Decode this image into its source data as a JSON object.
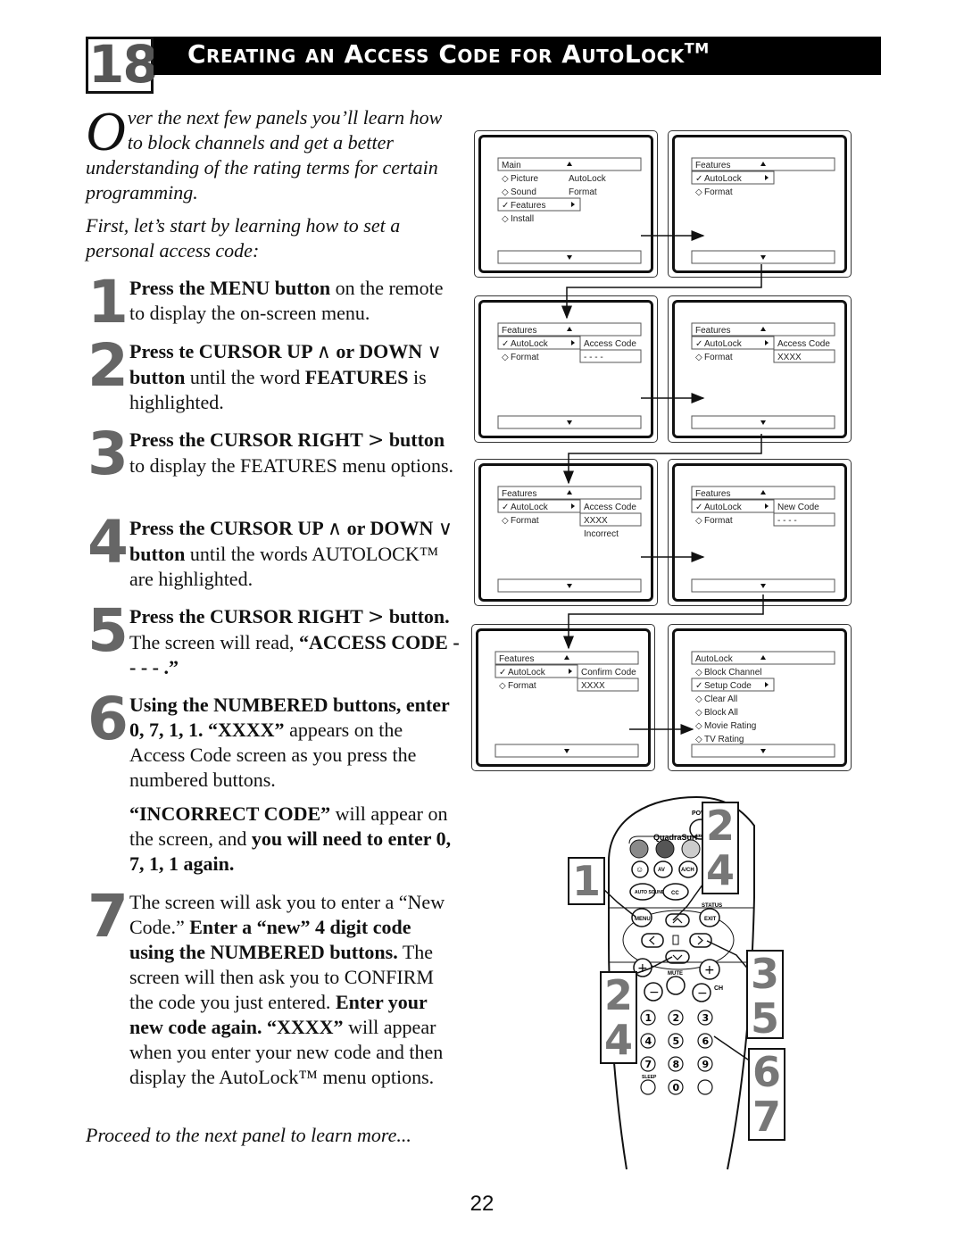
{
  "header": {
    "section_number": "18",
    "title": "Creating an Access Code for AutoLock",
    "title_trademark": "TM"
  },
  "intro": {
    "dropcap": "O",
    "paragraph1_rest": "ver the next few panels you’ll learn how to block channels and get a better understanding of the rating terms for certain programming.",
    "paragraph2": "First, let’s start by learning how to set a personal access code:"
  },
  "steps": [
    {
      "number": "1",
      "parts": [
        {
          "b": "Press the MENU button"
        },
        {
          "t": " on the remote to display the on-screen menu."
        }
      ]
    },
    {
      "number": "2",
      "parts": [
        {
          "b": "Press te CURSOR UP "
        },
        {
          "s": "∧"
        },
        {
          "b": "  or  DOWN "
        },
        {
          "s": "∨"
        },
        {
          "b": "  button"
        },
        {
          "t": " until the word "
        },
        {
          "b": "FEATURES"
        },
        {
          "t": " is highlighted."
        }
      ]
    },
    {
      "number": "3",
      "parts": [
        {
          "b": "Press the CURSOR RIGHT "
        },
        {
          "s": ">"
        },
        {
          "b": " button"
        },
        {
          "t": " to display the FEATURES menu options."
        }
      ]
    },
    {
      "number": "4",
      "parts": [
        {
          "b": "Press the CURSOR UP "
        },
        {
          "s": "∧"
        },
        {
          "b": "  or DOWN "
        },
        {
          "s": "∨"
        },
        {
          "b": " button"
        },
        {
          "t": " until the words AUTOLOCK™ are highlighted."
        }
      ]
    },
    {
      "number": "5",
      "parts": [
        {
          "b": "Press the CURSOR RIGHT "
        },
        {
          "s": ">"
        },
        {
          "b": " button."
        },
        {
          "t": " The screen will read, "
        },
        {
          "b": "“ACCESS CODE - - - - .”"
        }
      ]
    },
    {
      "number": "6",
      "parts": [
        {
          "b": "Using the NUMBERED buttons, enter 0, 7, 1, 1. “XXXX”"
        },
        {
          "t": " appears on the Access Code screen as you press the numbered buttons."
        }
      ]
    },
    {
      "number": "",
      "parts": [
        {
          "b": "“INCORRECT CODE”"
        },
        {
          "t": " will appear on the screen, and "
        },
        {
          "b": "you will need to enter 0, 7, 1, 1 again."
        }
      ]
    },
    {
      "number": "7",
      "parts": [
        {
          "t": "The screen will ask you to enter a “New Code.” "
        },
        {
          "b": "Enter a “new” 4 digit code using the NUMBERED buttons."
        },
        {
          "t": " The screen will then ask you to CONFIRM the code you just entered. "
        },
        {
          "b": "Enter your new code again. “XXXX”"
        },
        {
          "t": " will appear when you enter your new code and then display the AutoLock™ menu options."
        }
      ]
    }
  ],
  "proceed": "Proceed to the next panel to learn more...",
  "page_number": "22",
  "screens": [
    {
      "header": "Main",
      "items": [
        {
          "label": "Picture",
          "mark": "◇"
        },
        {
          "label": "Sound",
          "mark": "◇"
        },
        {
          "label": "Features",
          "mark": "✓",
          "selected": true
        },
        {
          "label": "Install",
          "mark": "◇"
        }
      ],
      "side": [
        "AutoLock",
        "Format"
      ],
      "side_boxed": false
    },
    {
      "header": "Features",
      "items": [
        {
          "label": "AutoLock",
          "mark": "✓",
          "selected": true
        },
        {
          "label": "Format",
          "mark": "◇"
        }
      ],
      "side": [],
      "side_boxed": false
    },
    {
      "header": "Features",
      "items": [
        {
          "label": "AutoLock",
          "mark": "✓",
          "selected": true
        },
        {
          "label": "Format",
          "mark": "◇"
        }
      ],
      "side": [
        "Access Code",
        "- - - -"
      ],
      "side_boxed": true
    },
    {
      "header": "Features",
      "items": [
        {
          "label": "AutoLock",
          "mark": "✓",
          "selected": true
        },
        {
          "label": "Format",
          "mark": "◇"
        }
      ],
      "side": [
        "Access Code",
        "XXXX"
      ],
      "side_boxed": true
    },
    {
      "header": "Features",
      "items": [
        {
          "label": "AutoLock",
          "mark": "✓",
          "selected": true
        },
        {
          "label": "Format",
          "mark": "◇"
        }
      ],
      "side": [
        "Access Code",
        "XXXX",
        "Incorrect"
      ],
      "side_boxed": true
    },
    {
      "header": "Features",
      "items": [
        {
          "label": "AutoLock",
          "mark": "✓",
          "selected": true
        },
        {
          "label": "Format",
          "mark": "◇"
        }
      ],
      "side": [
        "New Code",
        "- - - -"
      ],
      "side_boxed": true
    },
    {
      "header": "Features",
      "items": [
        {
          "label": "AutoLock",
          "mark": "✓",
          "selected": true
        },
        {
          "label": "Format",
          "mark": "◇"
        }
      ],
      "side": [
        "Confirm Code",
        "XXXX"
      ],
      "side_boxed": true
    },
    {
      "header": "AutoLock",
      "items": [
        {
          "label": "Block Channel",
          "mark": "◇"
        },
        {
          "label": "Setup Code",
          "mark": "✓",
          "selected": true
        },
        {
          "label": "Clear All",
          "mark": "◇"
        },
        {
          "label": "Block All",
          "mark": "◇"
        },
        {
          "label": "Movie Rating",
          "mark": "◇"
        },
        {
          "label": "TV Rating",
          "mark": "◇"
        }
      ],
      "side": [],
      "side_boxed": false
    }
  ],
  "remote": {
    "brand_label": "QuadraSurf™",
    "power_label": "POWER",
    "buttons": {
      "av": "AV",
      "ach": "A/CH",
      "auto_sound": "AUTO SOUND",
      "cc": "CC",
      "menu": "MENU",
      "status": "STATUS",
      "exit": "EXIT",
      "mute": "MUTE",
      "ch": "CH",
      "sleep": "SLEEP"
    },
    "digits": [
      "1",
      "2",
      "3",
      "4",
      "5",
      "6",
      "7",
      "8",
      "9",
      "0"
    ],
    "callouts": [
      {
        "target": "menu",
        "lines": [
          "1"
        ]
      },
      {
        "target": "cursor-up",
        "lines": [
          "2",
          "4"
        ]
      },
      {
        "target": "cursor-down",
        "lines": [
          "2",
          "4"
        ]
      },
      {
        "target": "cursor-right",
        "lines": [
          "3",
          "5"
        ]
      },
      {
        "target": "number-pad",
        "lines": [
          "6",
          "7"
        ]
      }
    ]
  }
}
